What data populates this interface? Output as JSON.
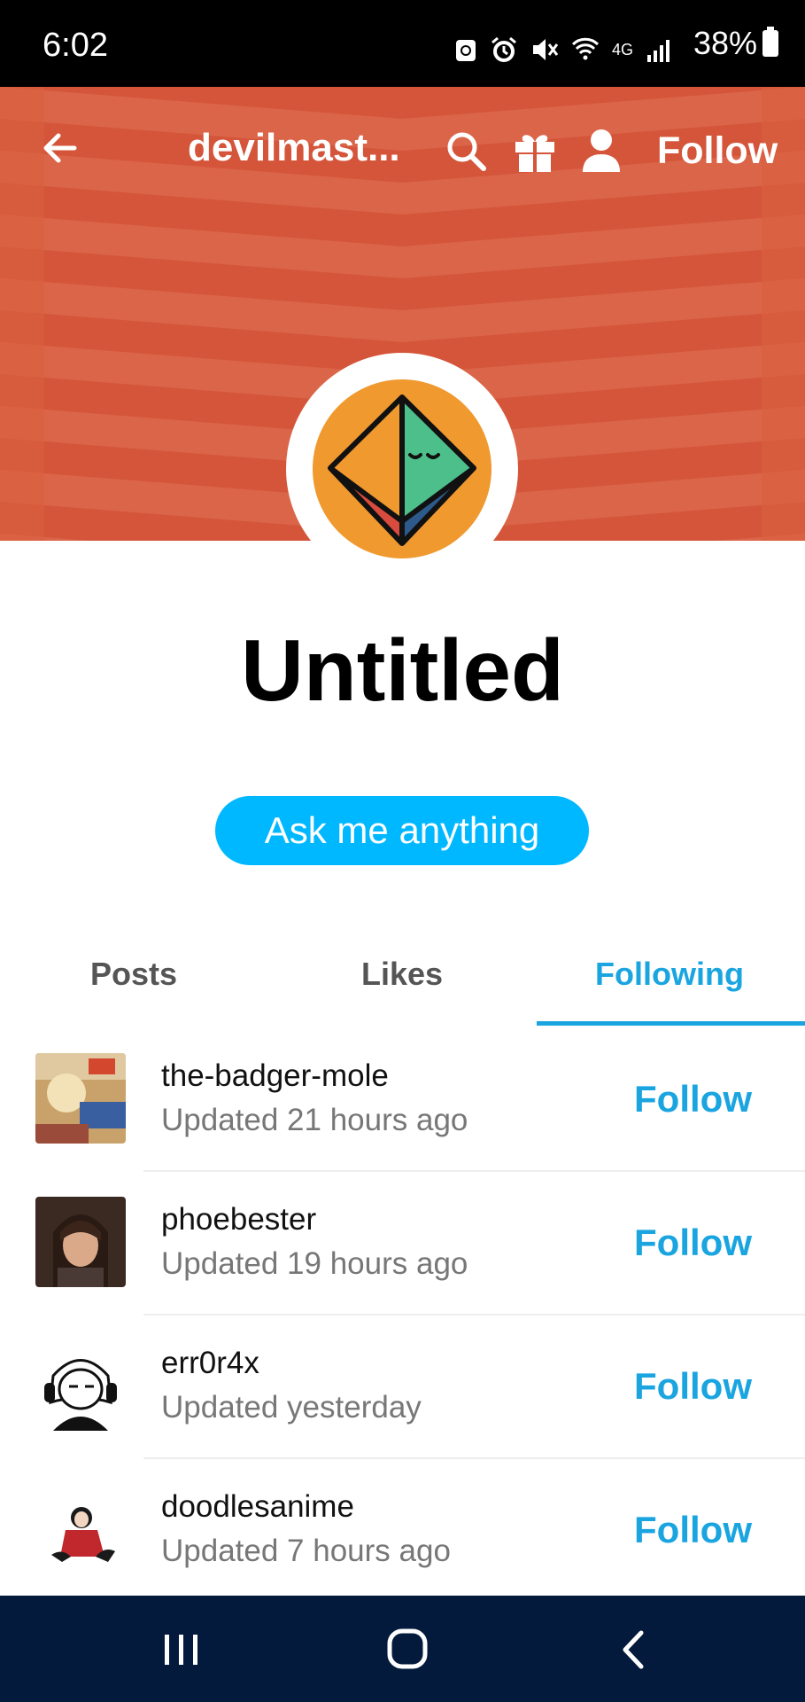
{
  "status_bar": {
    "time": "6:02",
    "network": "4G",
    "battery": "38%"
  },
  "header": {
    "blog_title": "devilmast...",
    "follow_label": "Follow",
    "banner_color": "#d4553a",
    "avatar_color": "#f0992f"
  },
  "profile": {
    "name": "Untitled",
    "ask_label": "Ask me anything"
  },
  "tabs": [
    {
      "label": "Posts",
      "active": false
    },
    {
      "label": "Likes",
      "active": false
    },
    {
      "label": "Following",
      "active": true
    }
  ],
  "following": [
    {
      "name": "the-badger-mole",
      "updated": "Updated 21 hours ago",
      "follow": "Follow"
    },
    {
      "name": "phoebester",
      "updated": "Updated 19 hours ago",
      "follow": "Follow"
    },
    {
      "name": "err0r4x",
      "updated": "Updated yesterday",
      "follow": "Follow"
    },
    {
      "name": "doodlesanime",
      "updated": "Updated 7 hours ago",
      "follow": "Follow"
    }
  ],
  "colors": {
    "accent": "#1aa5e0",
    "ask_button": "#00b8ff",
    "nav_bar": "#041a3c"
  }
}
